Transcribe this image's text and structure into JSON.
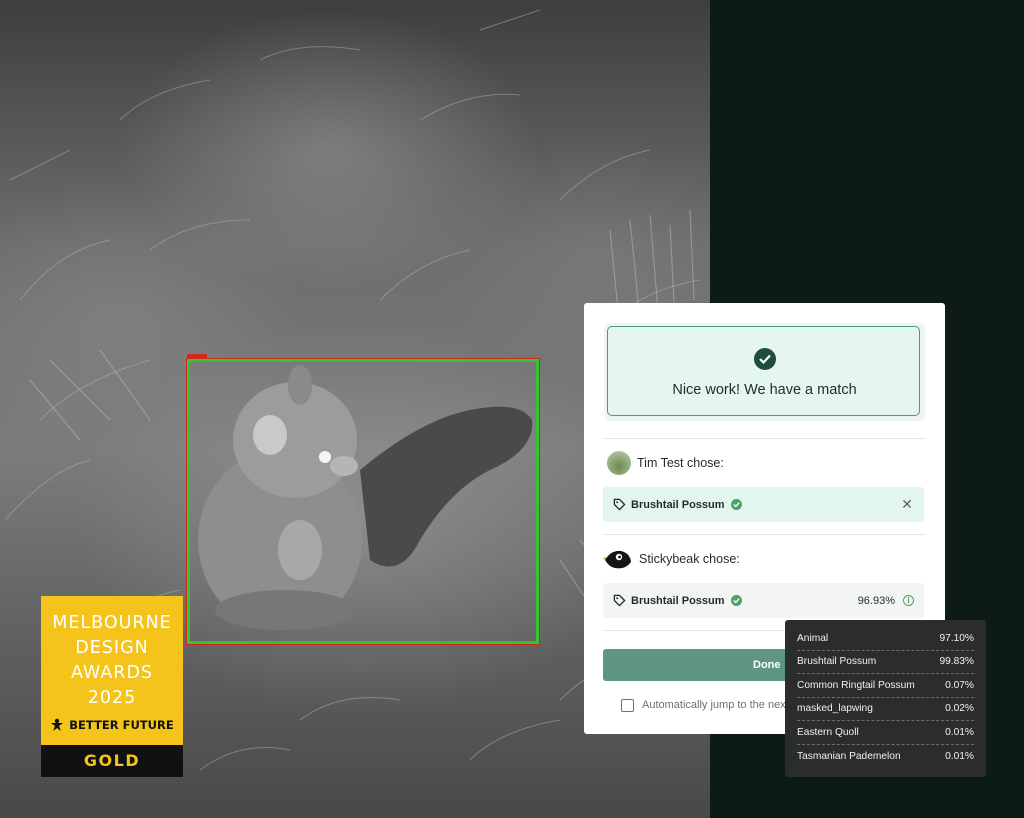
{
  "award": {
    "lines": [
      "MELBOURNE",
      "DESIGN",
      "AWARDS",
      "2025"
    ],
    "category": "BETTER FUTURE",
    "level": "GOLD",
    "color": "#f5c41c"
  },
  "detection": {
    "box_color": "#35c330",
    "tag_color": "#d02a1a"
  },
  "panel": {
    "match_message": "Nice work! We have a match",
    "user_choice": {
      "label": "Tim Test chose:",
      "species": "Brushtail Possum",
      "remove_icon": "close-icon"
    },
    "ai_choice": {
      "label": "Stickybeak chose:",
      "species": "Brushtail Possum",
      "confidence": "96.93%"
    },
    "done_label": "Done",
    "auto_jump_label": "Automatically jump to the next",
    "auto_jump_checked": false,
    "accent_color": "#5e9682"
  },
  "probabilities": [
    {
      "label": "Animal",
      "value": "97.10%"
    },
    {
      "label": "Brushtail Possum",
      "value": "99.83%"
    },
    {
      "label": "Common Ringtail Possum",
      "value": "0.07%"
    },
    {
      "label": "masked_lapwing",
      "value": "0.02%"
    },
    {
      "label": "Eastern Quoll",
      "value": "0.01%"
    },
    {
      "label": "Tasmanian Pademelon",
      "value": "0.01%"
    }
  ]
}
